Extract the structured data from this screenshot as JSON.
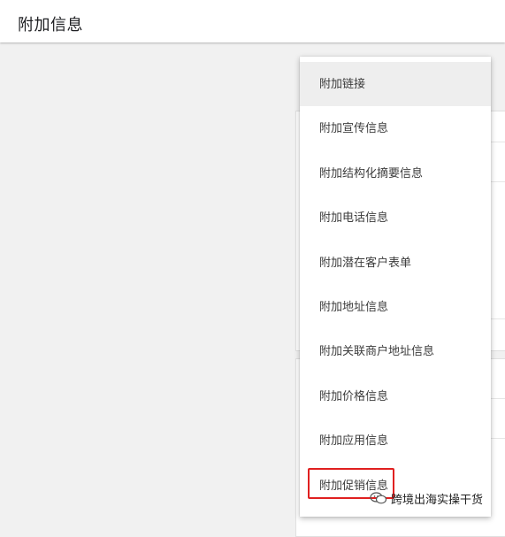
{
  "header": {
    "title": "附加信息"
  },
  "menu": {
    "items": [
      {
        "label": "附加链接",
        "active": true
      },
      {
        "label": "附加宣传信息",
        "active": false
      },
      {
        "label": "附加结构化摘要信息",
        "active": false
      },
      {
        "label": "附加电话信息",
        "active": false
      },
      {
        "label": "附加潜在客户表单",
        "active": false
      },
      {
        "label": "附加地址信息",
        "active": false
      },
      {
        "label": "附加关联商户地址信息",
        "active": false
      },
      {
        "label": "附加价格信息",
        "active": false
      },
      {
        "label": "附加应用信息",
        "active": false
      },
      {
        "label": "附加促销信息",
        "active": false,
        "highlighted": true
      }
    ]
  },
  "watermark": {
    "text": "跨境出海实操干货",
    "icon": "wechat-icon"
  },
  "colors": {
    "highlight": "#e02020",
    "active_item_bg": "#eeeeee"
  }
}
